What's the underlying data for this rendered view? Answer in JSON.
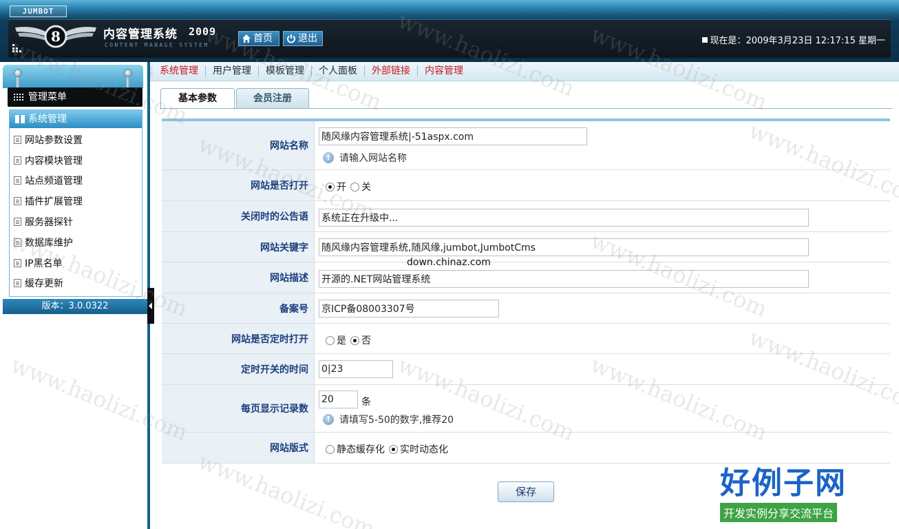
{
  "header": {
    "vendor_badge": "JUMBOT",
    "brand_title": "内容管理系统",
    "brand_year": "2009",
    "brand_subtitle": "CONTENT MANAGE SYSTEM",
    "home_label": "首页",
    "logout_label": "退出",
    "datetime_label": "现在是：",
    "datetime_value": "2009年3月23日 12:17:15 星期一"
  },
  "nav": {
    "items": [
      {
        "label": "系统管理",
        "color": "#c8161b"
      },
      {
        "label": "用户管理",
        "color": "#1c2b36"
      },
      {
        "label": "模板管理",
        "color": "#1c2b36"
      },
      {
        "label": "个人面板",
        "color": "#1c2b36"
      },
      {
        "label": "外部链接",
        "color": "#c8161b"
      },
      {
        "label": "内容管理",
        "color": "#c8161b"
      }
    ]
  },
  "sidebar": {
    "menu_title": "管理菜单",
    "section_title": "系统管理",
    "items": [
      {
        "label": "网站参数设置"
      },
      {
        "label": "内容模块管理"
      },
      {
        "label": "站点频道管理"
      },
      {
        "label": "插件扩展管理"
      },
      {
        "label": "服务器探针"
      },
      {
        "label": "数据库维护"
      },
      {
        "label": "IP黑名单"
      },
      {
        "label": "缓存更新"
      }
    ],
    "version": "版本：3.0.0322"
  },
  "tabs": [
    {
      "label": "基本参数",
      "active": true
    },
    {
      "label": "会员注册",
      "active": false
    }
  ],
  "form": {
    "site_name": {
      "label": "网站名称",
      "value": "随风缘内容管理系统|-51aspx.com",
      "hint": "请输入网站名称"
    },
    "site_open": {
      "label": "网站是否打开",
      "options": [
        "开",
        "关"
      ],
      "selected": "开"
    },
    "close_notice": {
      "label": "关闭时的公告语",
      "value": "系统正在升级中..."
    },
    "keywords": {
      "label": "网站关键字",
      "value": "随风缘内容管理系统,随风缘,jumbot,JumbotCms"
    },
    "description": {
      "label": "网站描述",
      "value": "开源的.NET网站管理系统"
    },
    "icp": {
      "label": "备案号",
      "value": "京ICP备08003307号"
    },
    "timed_open": {
      "label": "网站是否定时打开",
      "options": [
        "是",
        "否"
      ],
      "selected": "否"
    },
    "timed_range": {
      "label": "定时开关的时间",
      "value": "0|23"
    },
    "page_size": {
      "label": "每页显示记录数",
      "value": "20",
      "unit": "条",
      "hint": "请填写5-50的数字,推荐20"
    },
    "site_mode": {
      "label": "网站版式",
      "options": [
        "静态缓存化",
        "实时动态化"
      ],
      "selected": "实时动态化"
    }
  },
  "save_label": "保存",
  "overlay_url": "down.chinaz.com",
  "watermark_text": "www.haolizi.com",
  "brand_watermark": {
    "name": "好例子网",
    "slogan": "开发实例分享交流平台"
  }
}
